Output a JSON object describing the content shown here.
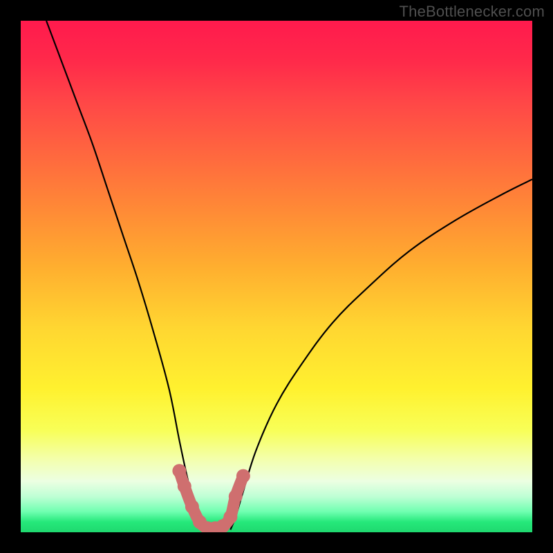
{
  "watermark": {
    "text": "TheBottlenecker.com"
  },
  "chart_data": {
    "type": "line",
    "title": "",
    "xlabel": "",
    "ylabel": "",
    "xlim": [
      0,
      100
    ],
    "ylim": [
      0,
      100
    ],
    "series": [
      {
        "name": "left-curve",
        "color": "#000000",
        "x": [
          5,
          8,
          11,
          14,
          17,
          20,
          23,
          26,
          29,
          31,
          32.5,
          34,
          35,
          36
        ],
        "y": [
          100,
          92,
          84,
          76,
          67,
          58,
          49,
          39,
          28,
          18,
          11,
          5,
          2,
          0.5
        ]
      },
      {
        "name": "right-curve",
        "color": "#000000",
        "x": [
          41,
          42,
          43.5,
          46,
          50,
          55,
          61,
          68,
          76,
          85,
          94,
          100
        ],
        "y": [
          0.5,
          3,
          8,
          16,
          25,
          33,
          41,
          48,
          55,
          61,
          66,
          69
        ]
      },
      {
        "name": "bottom-band",
        "color": "#cf6f6f",
        "type": "marker-band",
        "x": [
          31,
          32,
          33.5,
          35,
          36.5,
          38,
          39.5,
          41,
          42,
          43.5
        ],
        "y": [
          12,
          9,
          5,
          2,
          0.8,
          0.8,
          1.2,
          3,
          7,
          11
        ]
      }
    ],
    "legend": false,
    "grid": false,
    "background_gradient": {
      "top": "#ff1a4d",
      "upper_mid": "#ffae2f",
      "mid": "#fff12f",
      "lower": "#25e87a"
    }
  }
}
